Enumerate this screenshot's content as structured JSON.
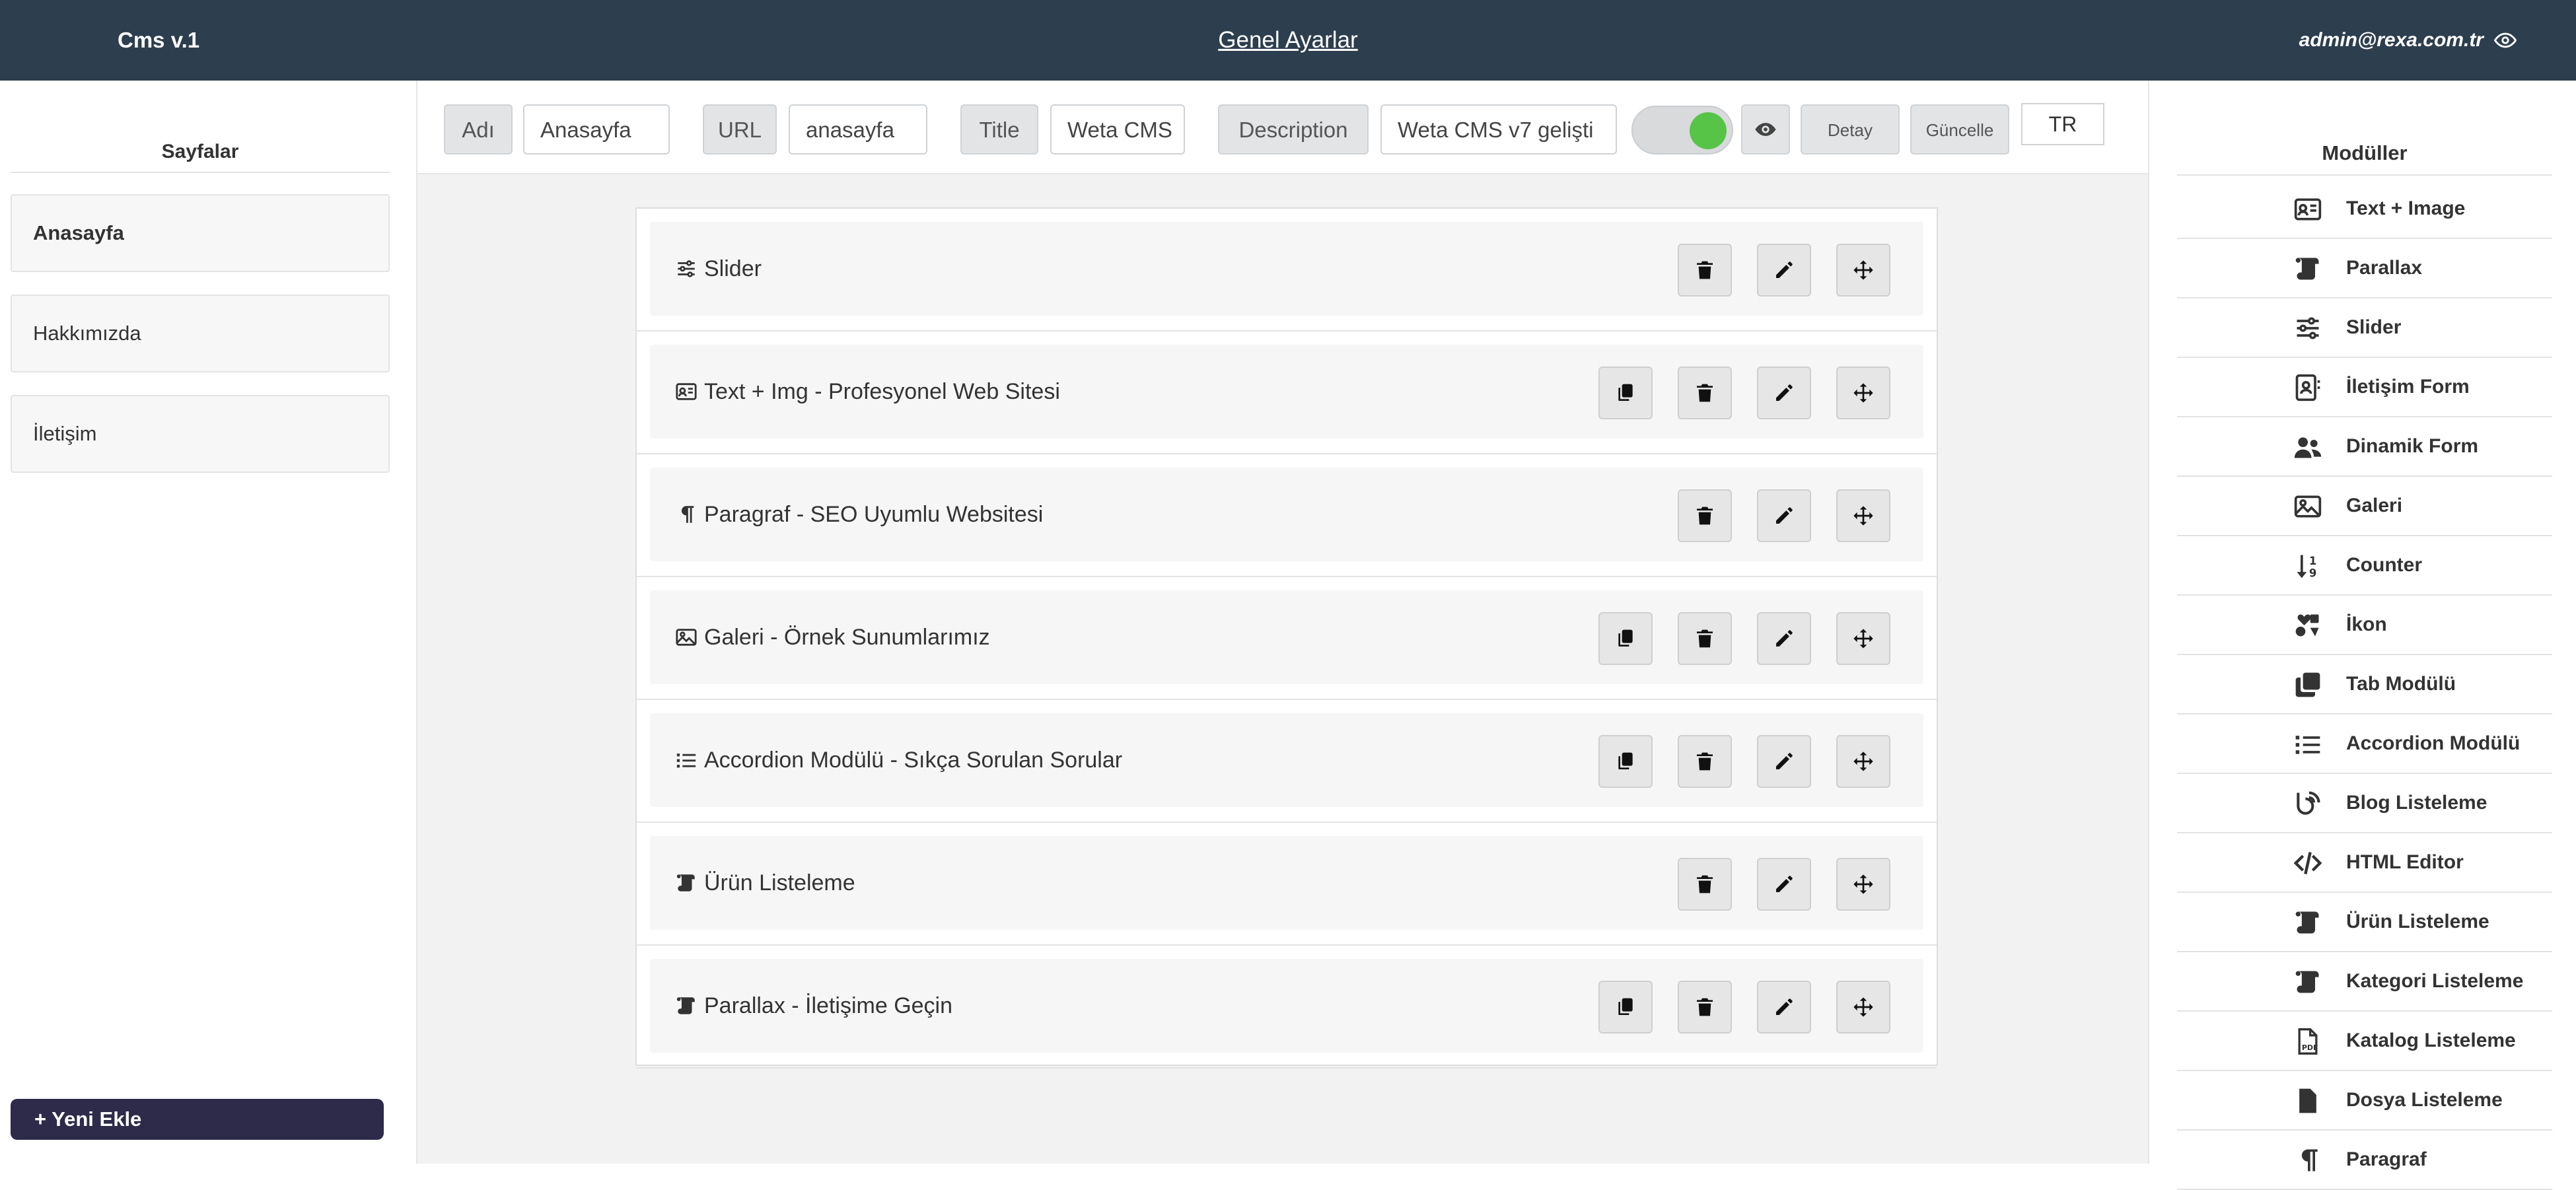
{
  "header": {
    "brand": "Cms v.1",
    "title": "Genel Ayarlar",
    "user_email": "admin@rexa.com.tr"
  },
  "left_sidebar": {
    "title": "Sayfalar",
    "pages": [
      "Anasayfa",
      "Hakkımızda",
      "İletişim"
    ],
    "add_button": "+ Yeni Ekle"
  },
  "toolbar": {
    "name_label": "Adı",
    "name_value": "Anasayfa",
    "url_label": "URL",
    "url_value": "anasayfa",
    "title_label": "Title",
    "title_value": "Weta CMS",
    "description_label": "Description",
    "description_value": "Weta CMS v7 gelişti",
    "detail_button": "Detay",
    "update_button": "Güncelle",
    "language": "TR",
    "toggle_color": "#57c447"
  },
  "modules": [
    {
      "label": "Slider",
      "icon": "sliders-icon",
      "copy": false
    },
    {
      "label": "Text + Img - Profesyonel Web Sitesi",
      "icon": "id-card-icon",
      "copy": true
    },
    {
      "label": "Paragraf - SEO Uyumlu Websitesi",
      "icon": "paragraph-icon",
      "copy": false
    },
    {
      "label": "Galeri - Örnek Sunumlarımız",
      "icon": "image-icon",
      "copy": true
    },
    {
      "label": "Accordion Modülü - Sıkça Sorulan Sorular",
      "icon": "list-icon",
      "copy": true
    },
    {
      "label": "Ürün Listeleme",
      "icon": "scroll-icon",
      "copy": false
    },
    {
      "label": "Parallax - İletişime Geçin",
      "icon": "scroll-icon",
      "copy": true
    }
  ],
  "right_sidebar": {
    "title": "Modüller",
    "items": [
      {
        "label": "Text + Image",
        "icon": "id-card-icon"
      },
      {
        "label": "Parallax",
        "icon": "scroll-icon"
      },
      {
        "label": "Slider",
        "icon": "sliders-icon"
      },
      {
        "label": "İletişim Form",
        "icon": "contact-icon"
      },
      {
        "label": "Dinamik Form",
        "icon": "users-icon"
      },
      {
        "label": "Galeri",
        "icon": "image-icon"
      },
      {
        "label": "Counter",
        "icon": "sort-numeric-icon"
      },
      {
        "label": "İkon",
        "icon": "icons-icon"
      },
      {
        "label": "Tab Modülü",
        "icon": "clone-icon"
      },
      {
        "label": "Accordion Modülü",
        "icon": "list-icon"
      },
      {
        "label": "Blog Listeleme",
        "icon": "blog-icon"
      },
      {
        "label": "HTML Editor",
        "icon": "code-icon"
      },
      {
        "label": "Ürün Listeleme",
        "icon": "scroll-icon"
      },
      {
        "label": "Kategori Listeleme",
        "icon": "scroll-icon"
      },
      {
        "label": "Katalog Listeleme",
        "icon": "pdf-icon"
      },
      {
        "label": "Dosya Listeleme",
        "icon": "file-icon"
      },
      {
        "label": "Paragraf",
        "icon": "paragraph-icon"
      }
    ]
  }
}
